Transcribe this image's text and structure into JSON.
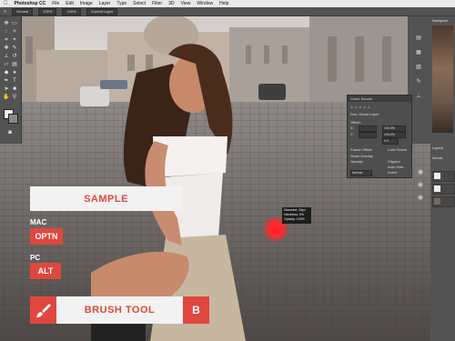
{
  "menubar": {
    "apple_glyph": "",
    "app_name": "Photoshop CC",
    "items": [
      "File",
      "Edit",
      "Image",
      "Layer",
      "Type",
      "Select",
      "Filter",
      "3D",
      "View",
      "Window",
      "Help"
    ]
  },
  "options_bar": {
    "mode_value": "Normal",
    "opacity_value": "100%",
    "flow_value": "100%",
    "sample_value": "Current Layer"
  },
  "clone_panel": {
    "title": "Clone Source",
    "source_name": "Doc: Ghost Layer",
    "offset_label": "Offset:",
    "x_label": "X:",
    "y_label": "Y:",
    "w_value": "100.0%",
    "h_value": "100.0%",
    "angle_value": "0.0",
    "frame_offset_label": "Frame Offset:",
    "lock_frame_label": "Lock Frame",
    "show_overlay_label": "Show Overlay",
    "clipped_label": "Clipped",
    "opacity_label": "Opacity:",
    "auto_hide_label": "Auto Hide",
    "normal_value": "Normal",
    "invert_label": "Invert"
  },
  "navigator": {
    "title": "Navigator"
  },
  "layers": {
    "title": "Layers",
    "mode_value": "Normal"
  },
  "brush_tooltip": {
    "diameter": "Diameter: 26px",
    "hardness": "Hardness: 0%",
    "opacity": "Opacity: 100%"
  },
  "overlay": {
    "sample_label": "SAMPLE",
    "mac_label": "MAC",
    "mac_key": "OPTN",
    "pc_label": "PC",
    "pc_key": "ALT",
    "tool_name": "BRUSH TOOL",
    "tool_shortcut": "B",
    "accent_color": "#e0473f"
  },
  "icons": {
    "brush": "brush-icon",
    "tools": [
      "move-tool-icon",
      "marquee-tool-icon",
      "lasso-tool-icon",
      "quick-select-tool-icon",
      "crop-tool-icon",
      "eyedropper-tool-icon",
      "healing-tool-icon",
      "brush-tool-icon",
      "clone-stamp-tool-icon",
      "history-brush-icon",
      "eraser-tool-icon",
      "gradient-tool-icon",
      "blur-tool-icon",
      "dodge-tool-icon",
      "pen-tool-icon",
      "type-tool-icon",
      "path-select-icon",
      "shape-tool-icon",
      "hand-tool-icon",
      "zoom-tool-icon"
    ]
  }
}
